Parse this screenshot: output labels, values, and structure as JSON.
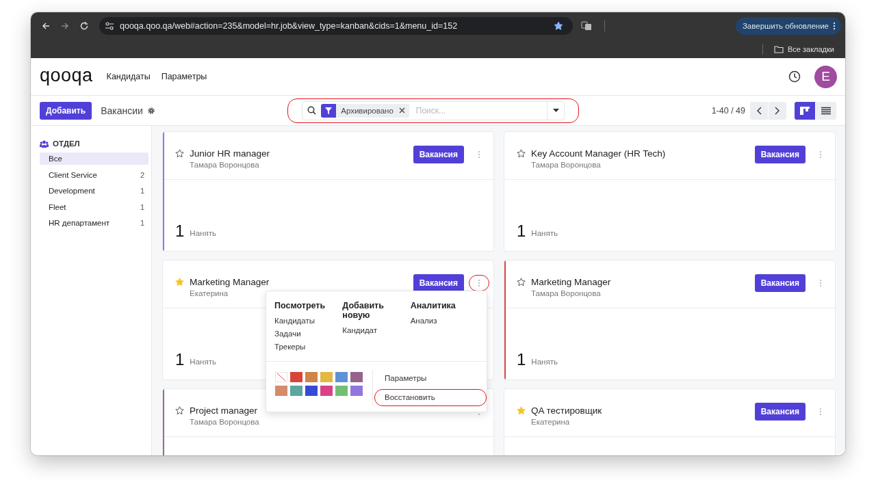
{
  "browser": {
    "url": "qooqa.qoo.qa/web#action=235&model=hr.job&view_type=kanban&cids=1&menu_id=152",
    "bookmarked": true,
    "update_button": "Завершить обновление",
    "bookmarks_folder": "Все закладки"
  },
  "navbar": {
    "logo": "qooqa",
    "menu": [
      "Кандидаты",
      "Параметры"
    ],
    "avatar": "E"
  },
  "control_panel": {
    "add_button": "Добавить",
    "breadcrumb": "Вакансии",
    "search": {
      "highlighted": true,
      "facet": "Архивировано",
      "placeholder": "Поиск..."
    },
    "pager": "1-40 / 49",
    "views": [
      {
        "kind": "kanban",
        "selected": true
      },
      {
        "kind": "list",
        "selected": false
      }
    ]
  },
  "sidebar": {
    "header": "ОТДЕЛ",
    "items": [
      {
        "label": "Все",
        "selected": true
      },
      {
        "label": "Client Service",
        "count": "2",
        "selected": false
      },
      {
        "label": "Development",
        "count": "1",
        "selected": false
      },
      {
        "label": "Fleet",
        "count": "1",
        "selected": false
      },
      {
        "label": "HR департамент",
        "count": "1",
        "selected": false
      }
    ]
  },
  "cards": [
    {
      "title": "Junior HR manager",
      "manager": "Тамара Воронцова",
      "button": "Вакансия",
      "starred": false,
      "color": "#8f7ae3",
      "count": "1",
      "count_label": "Нанять",
      "menu_highlighted": false
    },
    {
      "title": "Key Account Manager (HR Tech)",
      "manager": "Тамара Воронцова",
      "button": "Вакансия",
      "starred": false,
      "count": "1",
      "count_label": "Нанять",
      "menu_highlighted": false
    },
    {
      "title": "Marketing Manager",
      "manager": "Екатерина",
      "button": "Вакансия",
      "starred": true,
      "count": "1",
      "count_label": "Нанять",
      "menu_highlighted": true,
      "dropdown": {
        "sections": [
          {
            "title": "Посмотреть",
            "items": [
              "Кандидаты",
              "Задачи",
              "Трекеры"
            ]
          },
          {
            "title": "Добавить новую",
            "items": [
              "Кандидат"
            ]
          },
          {
            "title": "Аналитика",
            "items": [
              "Анализ"
            ]
          }
        ],
        "colors": [
          {
            "kind": "none"
          },
          {
            "kind": "color",
            "color": "#d9443a"
          },
          {
            "kind": "color",
            "color": "#d08448"
          },
          {
            "kind": "color",
            "color": "#e2b945"
          },
          {
            "kind": "color",
            "color": "#5f91d6"
          },
          {
            "kind": "color",
            "color": "#94648a"
          },
          {
            "kind": "color",
            "color": "#d38b6a"
          },
          {
            "kind": "color",
            "color": "#5ba69e"
          },
          {
            "kind": "color",
            "color": "#3849d4"
          },
          {
            "kind": "color",
            "color": "#d94286"
          },
          {
            "kind": "color",
            "color": "#71c072"
          },
          {
            "kind": "color",
            "color": "#9077dd"
          }
        ],
        "actions": [
          {
            "label": "Параметры",
            "highlighted": false
          },
          {
            "label": "Восстановить",
            "highlighted": true
          }
        ]
      }
    },
    {
      "title": "Marketing Manager",
      "manager": "Тамара Воронцова",
      "button": "Вакансия",
      "starred": false,
      "color": "#e04848",
      "count": "1",
      "count_label": "Нанять",
      "menu_highlighted": false
    },
    {
      "title": "Project manager",
      "manager": "Тамара Воронцова",
      "starred": false,
      "color": "#9b6b94",
      "menu_highlighted": false
    },
    {
      "title": "QA тестировщик",
      "manager": "Екатерина",
      "button": "Вакансия",
      "starred": true,
      "menu_highlighted": false
    }
  ]
}
